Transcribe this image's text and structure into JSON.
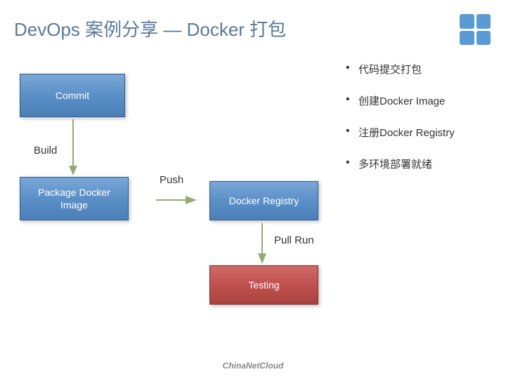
{
  "title": "DevOps 案例分享 — Docker 打包",
  "boxes": {
    "commit": "Commit",
    "package": "Package Docker Image",
    "registry": "Docker Registry",
    "testing": "Testing"
  },
  "arrows": {
    "build": "Build",
    "push": "Push",
    "pullrun": "Pull Run"
  },
  "bullets": [
    "代码提交打包",
    "创建Docker Image",
    "注册Docker Registry",
    "多环境部署就绪"
  ],
  "footer": "ChinaNetCloud",
  "colors": {
    "blue": "#5b8fc7",
    "red": "#c0504d",
    "title": "#5a7a9a",
    "logo": "#5b9bd5"
  }
}
